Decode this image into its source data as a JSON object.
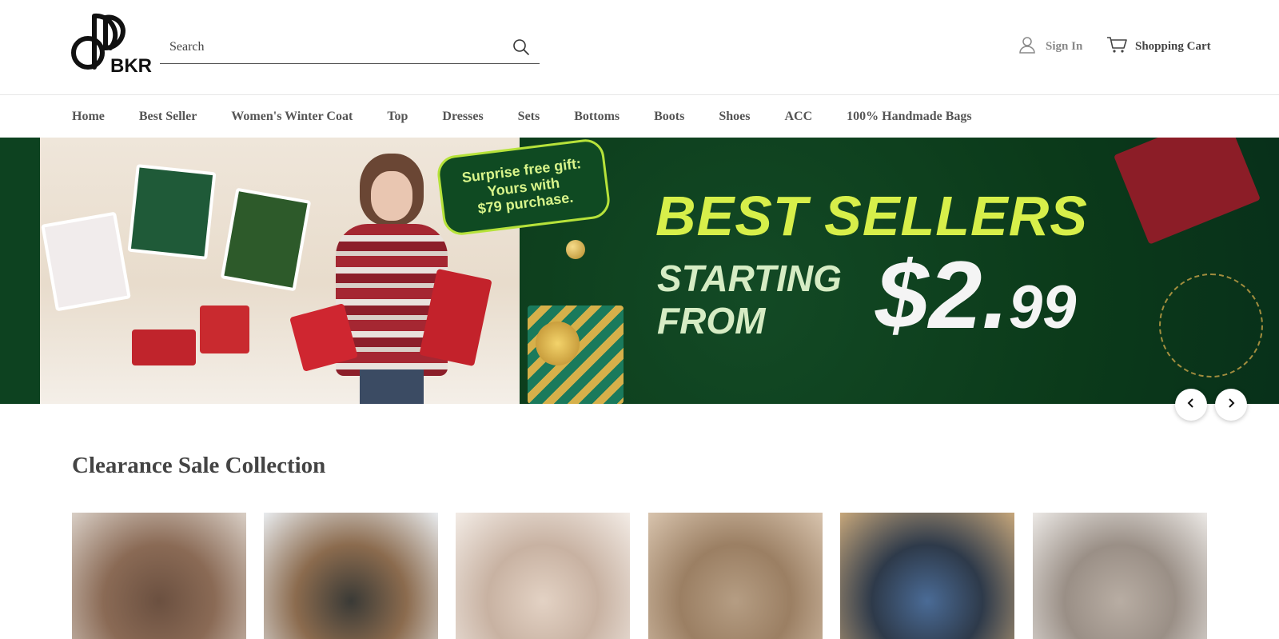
{
  "header": {
    "logo_text": "BKR",
    "search_placeholder": "Search",
    "sign_in_label": "Sign In",
    "cart_label": "Shopping Cart"
  },
  "nav": {
    "items": [
      "Home",
      "Best Seller",
      "Women's Winter Coat",
      "Top",
      "Dresses",
      "Sets",
      "Bottoms",
      "Boots",
      "Shoes",
      "ACC",
      "100% Handmade Bags"
    ]
  },
  "banner": {
    "bubble_text": "Surprise free gift:\nYours with\n$79 purchase.",
    "headline": "BEST SELLERS",
    "subline": "STARTING\nFROM",
    "price_main": "$2.",
    "price_cents": "99"
  },
  "section": {
    "title": "Clearance Sale Collection"
  },
  "products": [
    {
      "name": "boots",
      "colors": [
        "#6b5040",
        "#8a6a55",
        "#d9cfc6"
      ]
    },
    {
      "name": "hooded-coats",
      "colors": [
        "#3a3a36",
        "#8b6b4e",
        "#e9ecef"
      ]
    },
    {
      "name": "wrap-sweater",
      "colors": [
        "#e3d2c4",
        "#c8b2a2",
        "#f3ece6"
      ]
    },
    {
      "name": "knit-tank",
      "colors": [
        "#b59d83",
        "#9b7f63",
        "#d8c4ae"
      ]
    },
    {
      "name": "denim-dress",
      "colors": [
        "#4a6b96",
        "#2e3a4a",
        "#c7a77b"
      ]
    },
    {
      "name": "loungewear-set",
      "colors": [
        "#b8ada3",
        "#9a8f86",
        "#ece9e6"
      ]
    }
  ],
  "colors": {
    "banner_green": "#0b3d1d",
    "headline_yellow": "#d7ef4a",
    "gift_red": "#c0242c"
  }
}
